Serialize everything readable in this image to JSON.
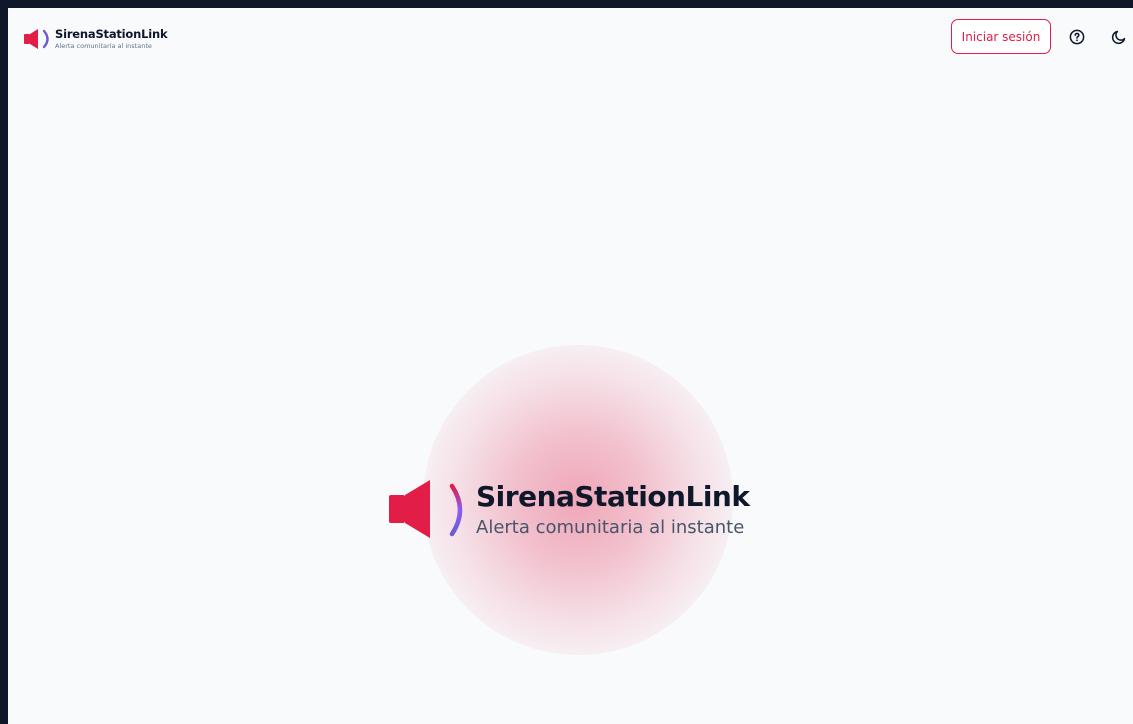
{
  "brand": {
    "name": "SirenaStationLink",
    "tagline": "Alerta comunitaria al instante"
  },
  "header": {
    "login_label": "Iniciar sesión",
    "help_icon": "help-circle-icon",
    "theme_icon": "moon-icon"
  },
  "hero": {
    "name": "SirenaStationLink",
    "tagline": "Alerta comunitaria al instante"
  },
  "colors": {
    "accent": "#e11d48",
    "arc": "#6d5bd0",
    "background": "#f8fafc",
    "text": "#0f172a"
  }
}
